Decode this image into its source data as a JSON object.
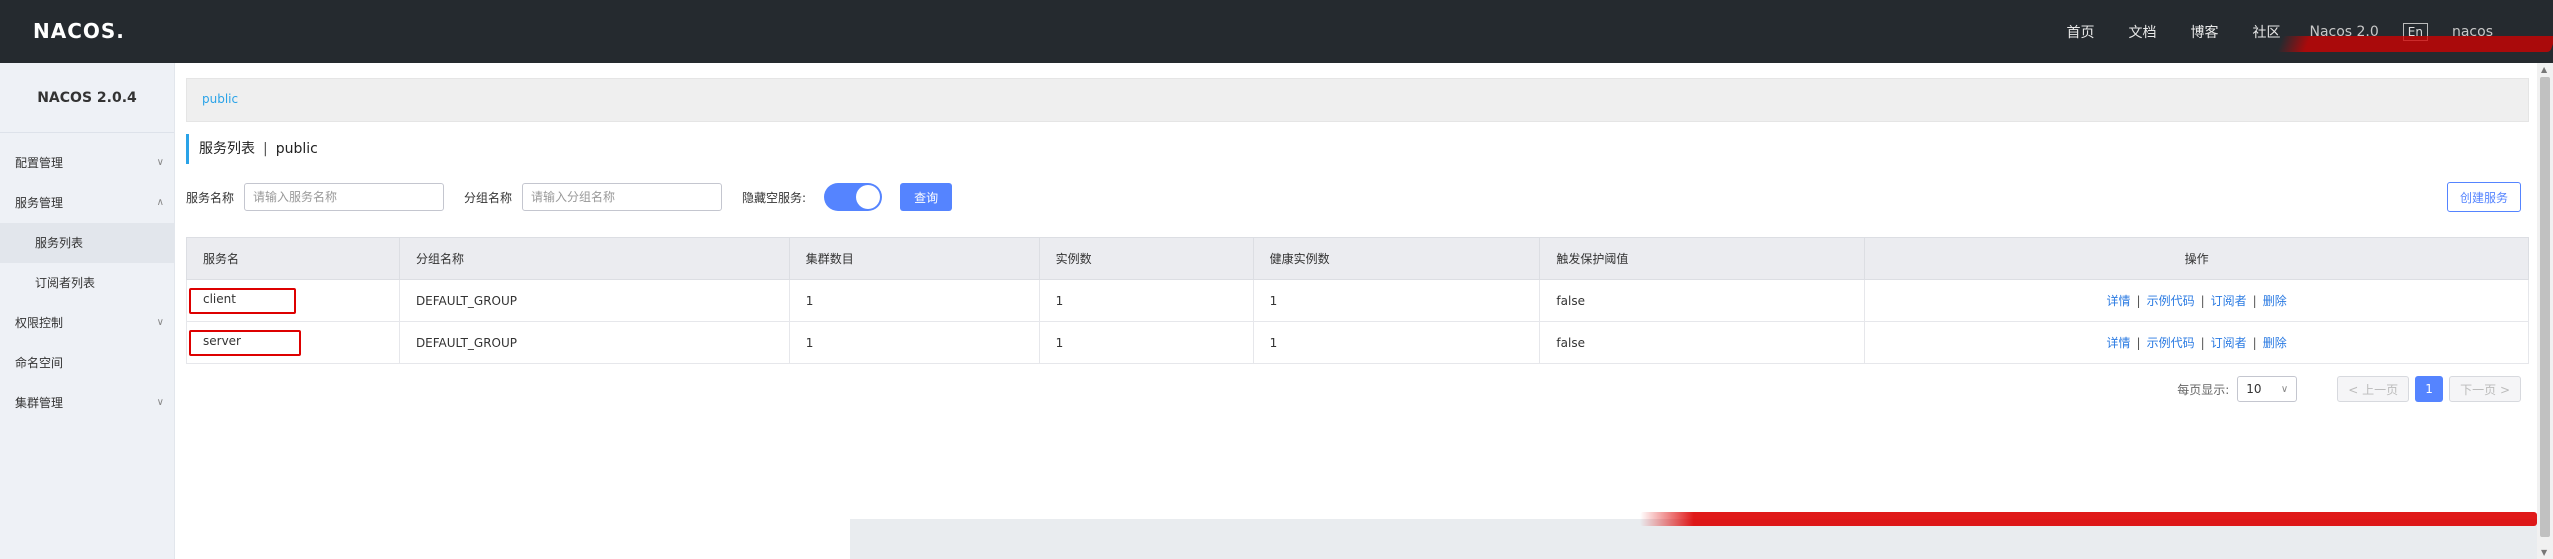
{
  "topbar": {
    "logo": "NACOS.",
    "nav": [
      "首页",
      "文档",
      "博客",
      "社区"
    ],
    "misc": [
      "Nacos 2.0",
      "En",
      "nacos"
    ]
  },
  "sidebar": {
    "version": "NACOS 2.0.4",
    "items": [
      {
        "label": "配置管理",
        "expanded": false
      },
      {
        "label": "服务管理",
        "expanded": true,
        "children": [
          "服务列表",
          "订阅者列表"
        ]
      },
      {
        "label": "权限控制",
        "expanded": false
      },
      {
        "label": "命名空间",
        "expanded": false
      },
      {
        "label": "集群管理",
        "expanded": false
      }
    ]
  },
  "namespace": {
    "current": "public"
  },
  "page": {
    "title": "服务列表",
    "separator": "|",
    "namespace": "public"
  },
  "filters": {
    "service_name_label": "服务名称",
    "service_name_placeholder": "请输入服务名称",
    "group_name_label": "分组名称",
    "group_name_placeholder": "请输入分组名称",
    "hide_empty_label": "隐藏空服务:",
    "hide_empty_on": true,
    "query_button": "查询",
    "create_button": "创建服务"
  },
  "table": {
    "headers": [
      "服务名",
      "分组名称",
      "集群数目",
      "实例数",
      "健康实例数",
      "触发保护阈值",
      "操作"
    ],
    "rows": [
      {
        "name": "client",
        "group": "DEFAULT_GROUP",
        "clusters": "1",
        "instances": "1",
        "healthy": "1",
        "threshold": "false"
      },
      {
        "name": "server",
        "group": "DEFAULT_GROUP",
        "clusters": "1",
        "instances": "1",
        "healthy": "1",
        "threshold": "false"
      }
    ],
    "ops": [
      "详情",
      "示例代码",
      "订阅者",
      "删除"
    ],
    "op_sep": "|"
  },
  "pagination": {
    "page_size_label": "每页显示:",
    "page_size": "10",
    "prev": "< 上一页",
    "current": "1",
    "next": "下一页 >"
  },
  "colors": {
    "primary": "#5584ff",
    "link": "#2a7ae2",
    "topbar": "#252a2f",
    "sidebar": "#eef1f6",
    "highlight": "#dd0000"
  }
}
